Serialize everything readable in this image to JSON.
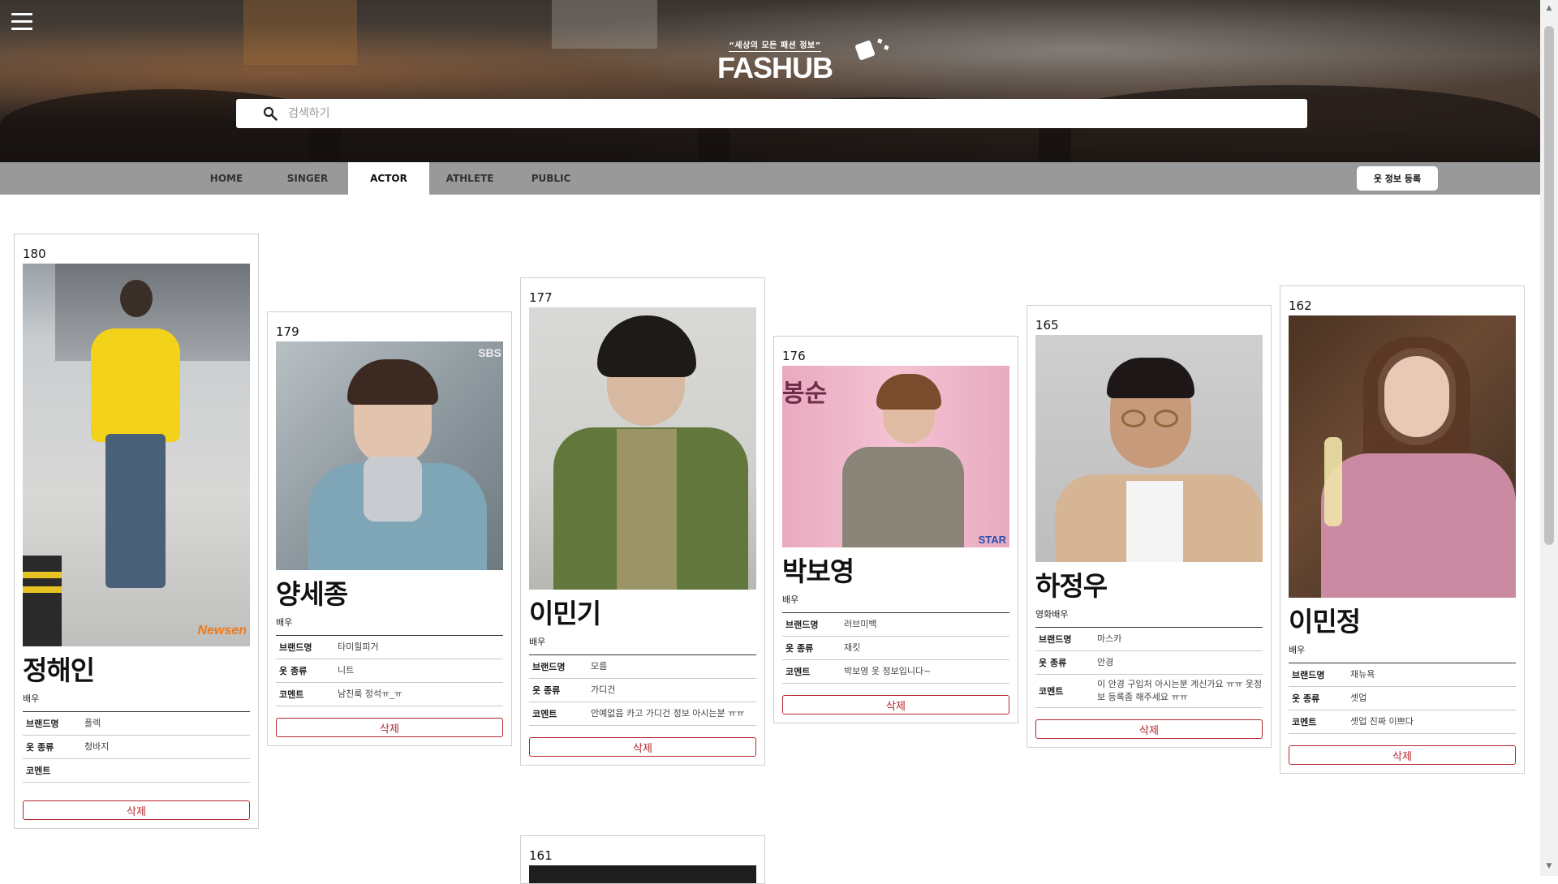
{
  "header": {
    "tagline": "“세상의 모든 패션 정보”",
    "brand": "FASHUB",
    "menu_icon": "hamburger-icon",
    "search": {
      "placeholder": "검색하기",
      "icon": "search-icon"
    }
  },
  "nav": {
    "tabs": [
      {
        "label": "HOME"
      },
      {
        "label": "SINGER"
      },
      {
        "label": "ACTOR",
        "active": true
      },
      {
        "label": "ATHLETE"
      },
      {
        "label": "PUBLIC"
      }
    ],
    "register_label": "옷 정보 등록"
  },
  "labels": {
    "brand": "브랜드명",
    "type": "옷 종류",
    "comment": "코멘트",
    "delete": "삭제"
  },
  "cards": [
    {
      "num": "180",
      "name": "정해인",
      "job": "배우",
      "brand": "플렉",
      "type": "청바지",
      "comment": ""
    },
    {
      "num": "179",
      "name": "양세종",
      "job": "배우",
      "brand": "타미힐피거",
      "type": "니트",
      "comment": "남친룩 정석ㅠ_ㅠ"
    },
    {
      "num": "177",
      "name": "이민기",
      "job": "배우",
      "brand": "모름",
      "type": "가디건",
      "comment": "안예없음 카고 가디건 정보 아시는분 ㅠㅠ"
    },
    {
      "num": "176",
      "name": "박보영",
      "job": "배우",
      "brand": "러브미백",
      "type": "재킷",
      "comment": "박보영 옷 정보입니다~"
    },
    {
      "num": "165",
      "name": "하정우",
      "job": "영화배우",
      "brand": "마스카",
      "type": "안경",
      "comment": "이 안경 구입처 아시는분 계신가요 ㅠㅠ 옷정보 등록좀 해주세요 ㅠㅠ"
    },
    {
      "num": "162",
      "name": "이민정",
      "job": "배우",
      "brand": "채뉴욕",
      "type": "셋업",
      "comment": "셋업 진짜 이쁘다"
    },
    {
      "num": "161"
    }
  ],
  "colors": {
    "accent": "#b3262d",
    "nav_bg": "#999999"
  },
  "photo_overlays": {
    "card1": "Newsen",
    "card2": "SBS",
    "card4_sign": "봉순",
    "card4_logo": "STAR"
  }
}
